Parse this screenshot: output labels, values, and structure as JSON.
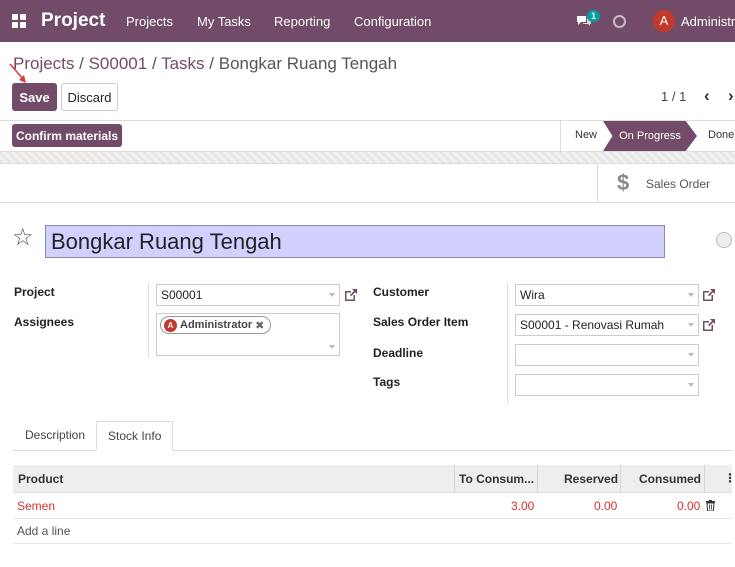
{
  "topbar": {
    "app_name": "Project",
    "menu": [
      "Projects",
      "My Tasks",
      "Reporting",
      "Configuration"
    ],
    "chat_count": "1",
    "avatar_letter": "A",
    "user_name": "Administrator",
    "color": "#714b67"
  },
  "breadcrumb": {
    "items": [
      "Projects",
      "S00001",
      "Tasks"
    ],
    "current": "Bongkar Ruang Tengah",
    "sep": " / "
  },
  "actions": {
    "save": "Save",
    "discard": "Discard"
  },
  "pager": {
    "text": "1 / 1",
    "prev": "‹",
    "next": "›"
  },
  "statusbar": {
    "confirm": "Confirm materials",
    "stages": [
      "New",
      "On Progress",
      "Done"
    ],
    "active_stage": "On Progress"
  },
  "smart_button": {
    "icon": "dollar-icon",
    "label": "Sales Order"
  },
  "task": {
    "title": "Bongkar Ruang Tengah"
  },
  "fields": {
    "project_label": "Project",
    "project_value": "S00001",
    "assignees_label": "Assignees",
    "assignee_tag": "Administrator",
    "assignee_letter": "A",
    "customer_label": "Customer",
    "customer_value": "Wira",
    "so_item_label": "Sales Order Item",
    "so_item_value": "S00001 - Renovasi Rumah",
    "deadline_label": "Deadline",
    "deadline_value": "",
    "tags_label": "Tags",
    "tags_value": ""
  },
  "tabs": [
    "Description",
    "Stock Info"
  ],
  "active_tab": "Stock Info",
  "table": {
    "columns": [
      "Product",
      "To Consum...",
      "Reserved",
      "Consumed"
    ],
    "rows": [
      {
        "product": "Semen",
        "to_consume": "3.00",
        "reserved": "0.00",
        "consumed": "0.00"
      }
    ],
    "add_line": "Add a line",
    "options_icon": "⋮"
  }
}
